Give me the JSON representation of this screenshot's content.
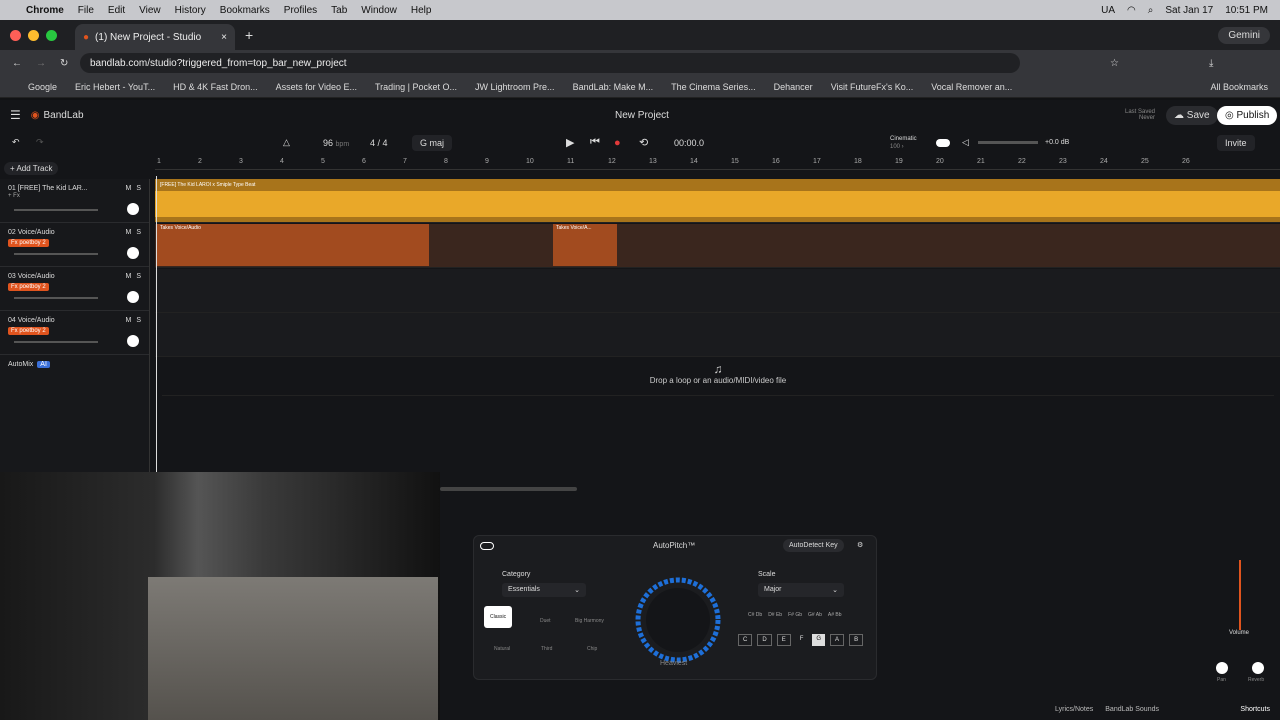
{
  "macos": {
    "menu": [
      "Chrome",
      "File",
      "Edit",
      "View",
      "History",
      "Bookmarks",
      "Profiles",
      "Tab",
      "Window",
      "Help"
    ],
    "status": [
      "UA",
      "Sat Jan 17",
      "10:51 PM"
    ]
  },
  "browser": {
    "tab_title": "(1) New Project - Studio",
    "url": "bandlab.com/studio?triggered_from=top_bar_new_project",
    "gemini": "Gemini",
    "bookmarks": [
      "Google",
      "Eric Hebert - YouT...",
      "HD & 4K Fast Dron...",
      "Assets for Video E...",
      "Trading | Pocket O...",
      "JW Lightroom Pre...",
      "BandLab: Make M...",
      "The Cinema Series...",
      "Dehancer",
      "Visit FutureFx's Ko...",
      "Vocal Remover an..."
    ],
    "all_bookmarks": "All Bookmarks"
  },
  "studio": {
    "brand": "BandLab",
    "project_title": "New Project",
    "last_saved_label": "Last Saved",
    "last_saved_value": "Never",
    "save": "Save",
    "publish": "Publish",
    "invite": "Invite",
    "bpm": "96",
    "bpm_unit": "bpm",
    "time_sig": "4 / 4",
    "key": "G maj",
    "time": "00:00.0",
    "cinematic": "Cinematic",
    "cinematic_value": "100 ›",
    "gain": "+0.0 dB",
    "add_track": "Add Track",
    "ruler": [
      "1",
      "2",
      "3",
      "4",
      "5",
      "6",
      "7",
      "8",
      "9",
      "10",
      "11",
      "12",
      "13",
      "14",
      "15",
      "16",
      "17",
      "18",
      "19",
      "20",
      "21",
      "22",
      "23",
      "24",
      "25",
      "26"
    ],
    "tracks": [
      {
        "label": "01 [FREE] The Kid LAR...",
        "fx": "+ Fx"
      },
      {
        "label": "02 Voice/Audio",
        "fx": "Fx poetboy 2"
      },
      {
        "label": "03 Voice/Audio",
        "fx": "Fx poetboy 2"
      },
      {
        "label": "04 Voice/Audio",
        "fx": "Fx poetboy 2"
      }
    ],
    "automix": "AutoMix",
    "automix_badge": "AI",
    "beat_region": "[FREE] The Kid LAROI x Smiple Type Beat",
    "takes1": "Takes  Voice/Audio",
    "takes2": "Takes Voice/A...",
    "drop_text": "Drop a loop or an audio/MIDI/video file"
  },
  "autopitch": {
    "title": "AutoPitch™",
    "autodetect": "AutoDetect Key",
    "category_label": "Category",
    "category": "Essentials",
    "styles": [
      "Classic",
      "Duet",
      "Big Harmony",
      "Natural",
      "Third",
      "Chip"
    ],
    "dial_label": "Heaviest",
    "scale_label": "Scale",
    "scale": "Major",
    "sharps": [
      "C# Db",
      "D# Eb",
      "F# Gb",
      "G# Ab",
      "A# Bb"
    ],
    "naturals": [
      "C",
      "D",
      "E",
      "F",
      "G",
      "A",
      "B"
    ],
    "volume": "Volume",
    "pan": "Pan",
    "reverb": "Reverb"
  },
  "bottom": {
    "lyrics": "Lyrics/Notes",
    "sounds": "BandLab Sounds",
    "shortcuts": "Shortcuts"
  },
  "colors": {
    "accent": "#e0541e",
    "beat": "#e8a524",
    "vocal": "#a24b1f"
  }
}
